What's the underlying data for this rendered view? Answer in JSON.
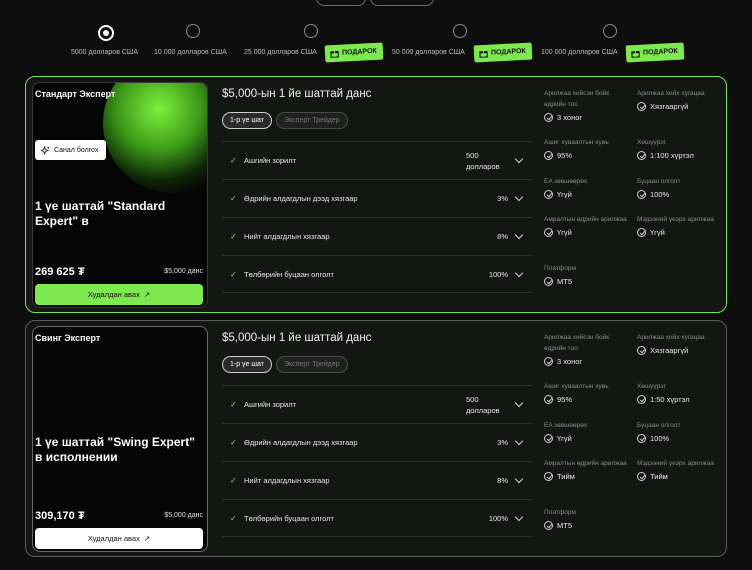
{
  "slider": {
    "steps": [
      {
        "label": "5000 долларов США",
        "active": true,
        "badge": ""
      },
      {
        "label": "10 000 долларов США",
        "active": false,
        "badge": ""
      },
      {
        "label": "25 000 долларов США",
        "active": false,
        "badge": "ПОДАРОК"
      },
      {
        "label": "50 000 долларов США",
        "active": false,
        "badge": "ПОДАРОК"
      },
      {
        "label": "100 000 долларов США",
        "active": false,
        "badge": "ПОДАРОК"
      }
    ]
  },
  "colors": {
    "accent": "#7ee84f",
    "background": "#0d0e0d",
    "card": "#141614"
  },
  "cards": [
    {
      "promo": {
        "title": "Стандарт Эксперт",
        "offer_button": "Санал болгох",
        "headline": "1 үе шаттай \"Standard Expert\" в",
        "price": "269 625 ₮",
        "account": "$5,000 данс",
        "buy_button": "Худалдан авах",
        "buy_icon": "↗"
      },
      "title": "$5,000-ын 1 йе шаттай данс",
      "tabs": [
        "1-р үе шат",
        "Эксперт Трейдер"
      ],
      "rows": [
        {
          "label": "Ашгийн зорилт",
          "value": "500 долларов"
        },
        {
          "label": "Өдрийн алдагдлын дээд хязгаар",
          "value": "3%"
        },
        {
          "label": "Нийт алдагдлын хязгаар",
          "value": "8%"
        },
        {
          "label": "Төлбөрийн буцаан олголт",
          "value": "100%"
        }
      ],
      "stats": [
        {
          "label": "Арилжаа хийсэн бойк өдрийн тоо",
          "value": "3 хоног"
        },
        {
          "label": "Арилжаа хийх хугацаа",
          "value": "Хязгааргүй"
        },
        {
          "label": "Ашиг хуваалтын хувь",
          "value": "95%"
        },
        {
          "label": "Хөшүүрэг",
          "value": "1:100 хүртэл"
        },
        {
          "label": "EA зөвшөөрөх",
          "value": "Үгүй"
        },
        {
          "label": "Буцаан олголт",
          "value": "100%"
        },
        {
          "label": "Амралтын өдрийн арилжаа",
          "value": "Үгүй"
        },
        {
          "label": "Мэдээний үеэрх арилжаа",
          "value": "Үгүй"
        },
        {
          "label": "Платформ",
          "value": "MT5"
        }
      ]
    },
    {
      "promo": {
        "title": "Свинг Эксперт",
        "offer_button": "",
        "headline": "1 үе шаттай \"Swing Expert\" в исполнении",
        "price": "309,170 ₮",
        "account": "$5,000 данс",
        "buy_button": "Худалдан авах",
        "buy_icon": "↗"
      },
      "title": "$5,000-ын 1 йе шаттай данс",
      "tabs": [
        "1-р үе шат",
        "Эксперт Трейдер"
      ],
      "rows": [
        {
          "label": "Ашгийн зорилт",
          "value": "500 долларов"
        },
        {
          "label": "Өдрийн алдагдлын дээд хязгаар",
          "value": "3%"
        },
        {
          "label": "Нийт алдагдлын хязгаар",
          "value": "8%"
        },
        {
          "label": "Төлбөрийн буцаан олголт",
          "value": "100%"
        }
      ],
      "stats": [
        {
          "label": "Арилжаа хийсэн бойк өдрийн тоо",
          "value": "3 хоног"
        },
        {
          "label": "Арилжаа хийх хугацаа",
          "value": "Хязгааргүй"
        },
        {
          "label": "Ашиг хуваалтын хувь",
          "value": "95%"
        },
        {
          "label": "Хөшүүрэг",
          "value": "1:50 хүртэл"
        },
        {
          "label": "EA зөвшөөрөх",
          "value": "Үгүй"
        },
        {
          "label": "Буцаан олголт",
          "value": "100%"
        },
        {
          "label": "Амралтын өдрийн арилжаа",
          "value": "Тийм"
        },
        {
          "label": "Мэдээний үеэрх арилжаа",
          "value": "Тийм"
        },
        {
          "label": "Платформ",
          "value": "MT5"
        }
      ]
    }
  ]
}
